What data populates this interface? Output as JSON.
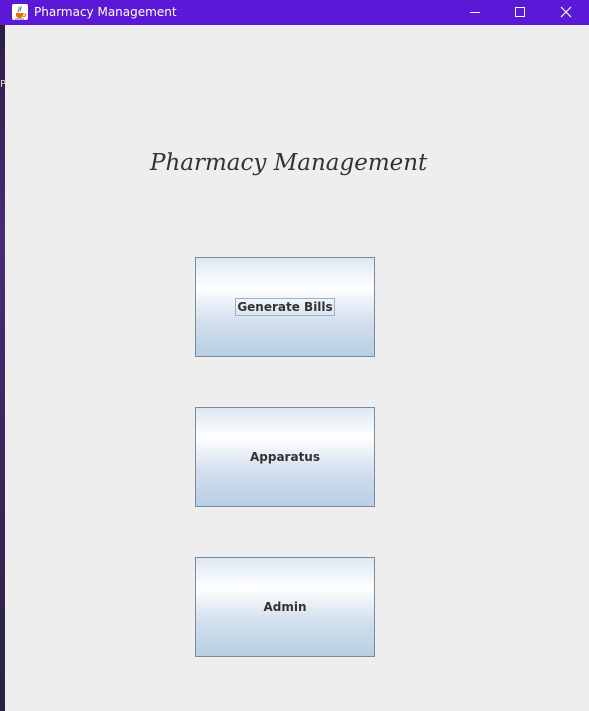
{
  "window": {
    "title": "Pharmacy Management",
    "titlebar_color": "#5b18d6",
    "app_icon": "java-cup-icon",
    "controls": {
      "minimize_icon": "minimize-icon",
      "maximize_icon": "maximize-icon",
      "close_icon": "close-icon"
    }
  },
  "background_edge_text": "P",
  "main": {
    "heading": "Pharmacy Management",
    "buttons": [
      {
        "label": "Generate Bills",
        "focused": true
      },
      {
        "label": "Apparatus",
        "focused": false
      },
      {
        "label": "Admin",
        "focused": false
      }
    ]
  }
}
